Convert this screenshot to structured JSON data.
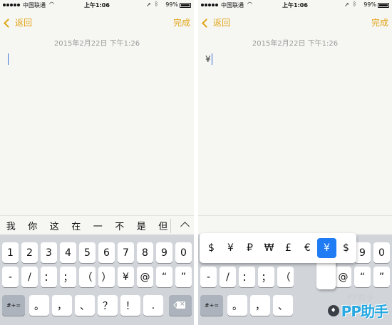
{
  "left_screen": {
    "status": {
      "carrier": "中国联通",
      "time": "上午1:06",
      "battery": "99%"
    },
    "nav": {
      "back": "返回",
      "done": "完成"
    },
    "date": "2015年2月22日 下午1:26",
    "candidates": [
      "我",
      "你",
      "这",
      "在",
      "一",
      "不",
      "是",
      "但"
    ],
    "rows": {
      "row1": [
        "1",
        "2",
        "3",
        "4",
        "5",
        "6",
        "7",
        "8",
        "9",
        "0"
      ],
      "row2": [
        "-",
        "/",
        "：",
        "；",
        "（",
        "）",
        "¥",
        "@",
        "“",
        "”"
      ],
      "row3_mode": "#+=",
      "row3": [
        "。",
        "，",
        "、",
        "？",
        "！",
        "."
      ]
    }
  },
  "right_screen": {
    "status": {
      "carrier": "中国联通",
      "time": "上午1:06",
      "battery": "99%"
    },
    "nav": {
      "back": "返回",
      "done": "完成"
    },
    "date": "2015年2月22日 下午1:26",
    "typed": "¥",
    "currency_popup": [
      "$",
      "¥",
      "₽",
      "₩",
      "£",
      "€",
      "¥",
      "$"
    ],
    "currency_selected_index": 6,
    "rows": {
      "row1_tail": [
        "9",
        "0"
      ],
      "row2_left": [
        "-",
        "/",
        "：",
        "；",
        "（"
      ],
      "row2_right": [
        "@",
        "“",
        "”"
      ],
      "row3_mode": "#+=",
      "row3": [
        "。",
        "，",
        "、"
      ]
    }
  },
  "watermark": {
    "top": "PP助手",
    "main": "PP助手"
  },
  "icons": [
    "signal-dots-icon",
    "wifi-icon",
    "location-arrow-icon",
    "bluetooth-icon",
    "battery-icon",
    "chevron-left-icon",
    "chevron-up-icon",
    "delete-backspace-icon"
  ],
  "colors": {
    "accent": "#e0a515",
    "selected": "#1f7cf5",
    "keyboard_bg": "#d1d5da"
  }
}
